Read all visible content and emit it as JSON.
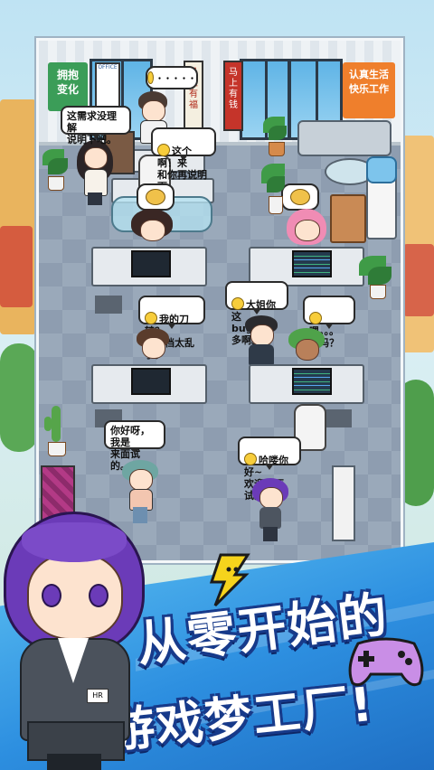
{
  "office": {
    "wall_sign_left": "拥抱\n变化",
    "wall_sign_right": "认真生活\n快乐工作",
    "banner_1": "马上有福",
    "banner_2": "马上有钱",
    "poster_text": "OFFICE"
  },
  "bubbles": {
    "manager": "这需求没理解\n说明下吧。",
    "top_worker": "这个啊！来\n和你再说明下。",
    "worker_knife": "我的刀转？\n这文档太乱了。",
    "worker_bug": "大姐你这\nbug有点多啊。",
    "worker_hm": "嗯。。。\n多吗？",
    "candidate": "你好呀，我是\n来面试的。",
    "greeter": "哈喽你好~\n欢迎来面试。",
    "boss_dots": "・・・・・"
  },
  "promo": {
    "line1": "从零开始的",
    "line2": "游戏梦工厂!",
    "badge": "HR"
  },
  "colors": {
    "sky": "#bfe3f3",
    "banner_blue": "#2d8fe0",
    "title_outline": "#173a8a",
    "bolt_yellow": "#f6d31c",
    "hair_purple": "#6b3bb8"
  },
  "icons": {
    "controller": "gamepad-icon",
    "bolt": "lightning-bolt-icon"
  }
}
